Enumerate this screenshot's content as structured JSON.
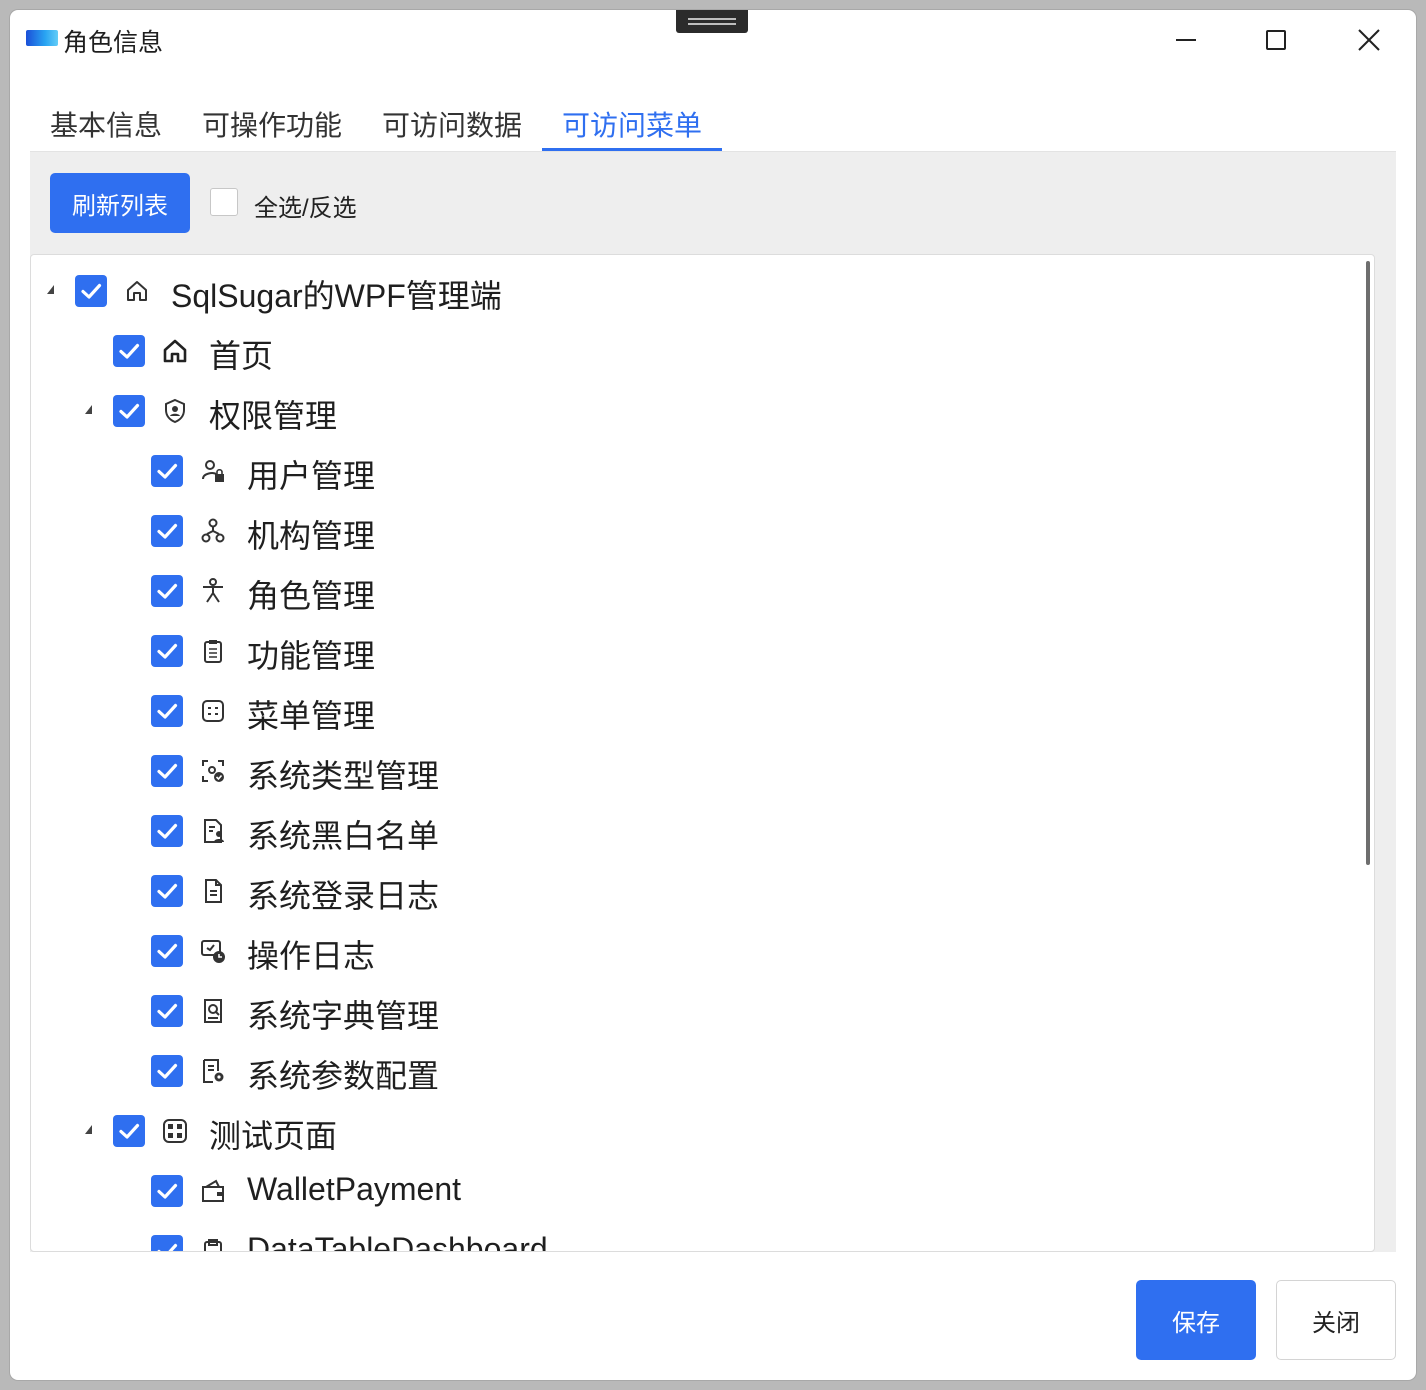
{
  "window": {
    "title": "角色信息"
  },
  "tabs": [
    {
      "label": "基本信息",
      "active": false
    },
    {
      "label": "可操作功能",
      "active": false
    },
    {
      "label": "可访问数据",
      "active": false
    },
    {
      "label": "可访问菜单",
      "active": true
    }
  ],
  "toolbar": {
    "refresh_label": "刷新列表",
    "select_all_label": "全选/反选",
    "select_all_checked": false
  },
  "tree": [
    {
      "label": "SqlSugar的WPF管理端",
      "level": 0,
      "expandable": true,
      "checked": true,
      "icon": "home-outline-icon"
    },
    {
      "label": "首页",
      "level": 1,
      "expandable": false,
      "checked": true,
      "icon": "home-icon"
    },
    {
      "label": "权限管理",
      "level": 1,
      "expandable": true,
      "checked": true,
      "icon": "shield-user-icon"
    },
    {
      "label": "用户管理",
      "level": 2,
      "expandable": false,
      "checked": true,
      "icon": "user-lock-icon"
    },
    {
      "label": "机构管理",
      "level": 2,
      "expandable": false,
      "checked": true,
      "icon": "org-tree-icon"
    },
    {
      "label": "角色管理",
      "level": 2,
      "expandable": false,
      "checked": true,
      "icon": "person-star-icon"
    },
    {
      "label": "功能管理",
      "level": 2,
      "expandable": false,
      "checked": true,
      "icon": "clipboard-list-icon"
    },
    {
      "label": "菜单管理",
      "level": 2,
      "expandable": false,
      "checked": true,
      "icon": "menu-box-icon"
    },
    {
      "label": "系统类型管理",
      "level": 2,
      "expandable": false,
      "checked": true,
      "icon": "type-settings-icon"
    },
    {
      "label": "系统黑白名单",
      "level": 2,
      "expandable": false,
      "checked": true,
      "icon": "document-user-icon"
    },
    {
      "label": "系统登录日志",
      "level": 2,
      "expandable": false,
      "checked": true,
      "icon": "document-icon"
    },
    {
      "label": "操作日志",
      "level": 2,
      "expandable": false,
      "checked": true,
      "icon": "screen-clock-icon"
    },
    {
      "label": "系统字典管理",
      "level": 2,
      "expandable": false,
      "checked": true,
      "icon": "dictionary-icon"
    },
    {
      "label": "系统参数配置",
      "level": 2,
      "expandable": false,
      "checked": true,
      "icon": "document-settings-icon"
    },
    {
      "label": "测试页面",
      "level": 1,
      "expandable": true,
      "checked": true,
      "icon": "grid-box-icon"
    },
    {
      "label": "WalletPayment",
      "level": 2,
      "expandable": false,
      "checked": true,
      "icon": "wallet-icon"
    },
    {
      "label": "DataTableDashboard",
      "level": 2,
      "expandable": false,
      "checked": true,
      "icon": "clipboard-icon"
    }
  ],
  "footer": {
    "save_label": "保存",
    "close_label": "关闭"
  },
  "colors": {
    "accent": "#2f6ff0",
    "content_bg": "#eeeeee",
    "text": "#1f1f1f"
  }
}
